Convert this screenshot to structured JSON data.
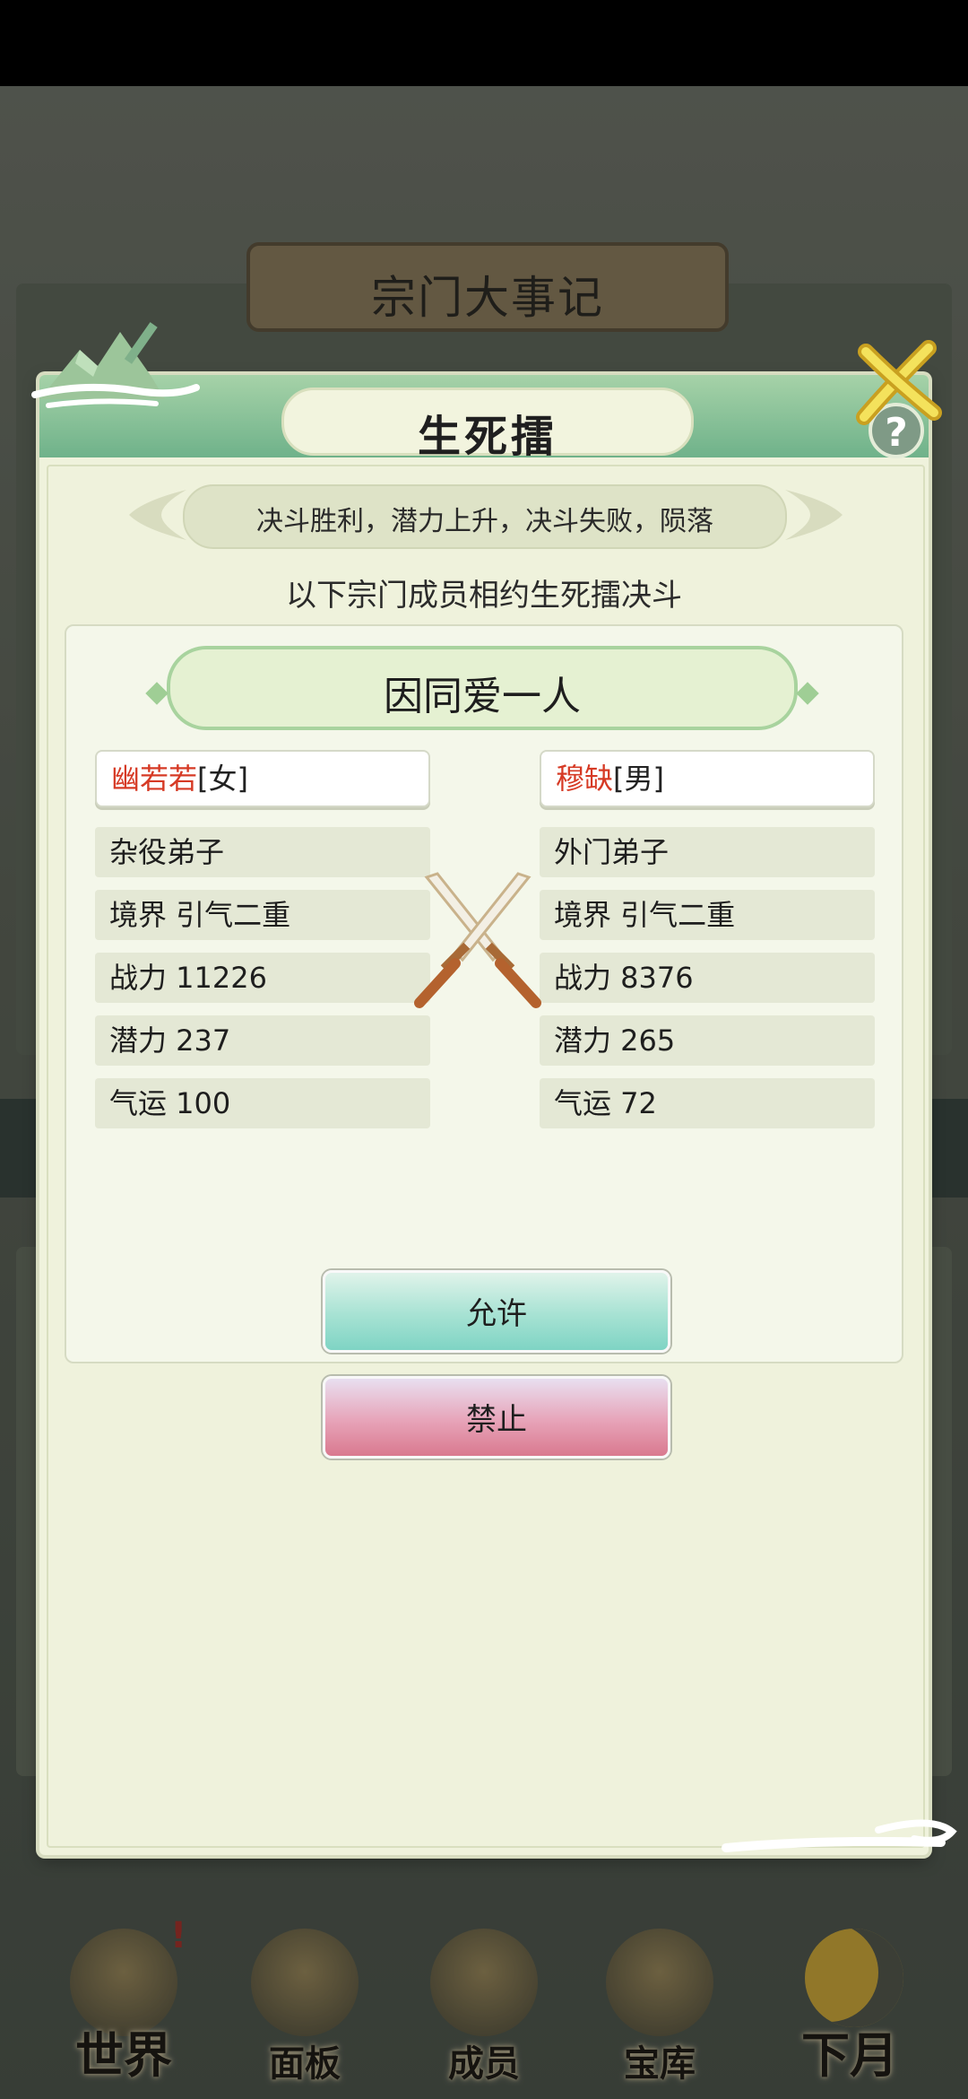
{
  "background": {
    "event_plaque_title": "宗门大事记"
  },
  "bottom_nav": {
    "items": [
      {
        "label": "世界",
        "icon": "world-pagoda-icon"
      },
      {
        "label": "面板",
        "icon": "panel-temple-icon"
      },
      {
        "label": "成员",
        "icon": "member-portrait-icon"
      },
      {
        "label": "宝库",
        "icon": "treasury-icon"
      },
      {
        "label": "下月",
        "icon": "moon-icon"
      }
    ],
    "alert_mark": "!"
  },
  "modal": {
    "title": "生死擂",
    "help_label": "?",
    "rule": "决斗胜利，潜力上升，决斗失败，陨落",
    "subtitle": "以下宗门成员相约生死擂决斗",
    "reason": "因同爱一人",
    "left": {
      "name": "幽若若",
      "gender": "[女]",
      "stats": [
        "杂役弟子",
        "境界 引气二重",
        "战力 11226",
        "潜力 237",
        "气运 100"
      ]
    },
    "right": {
      "name": "穆缺",
      "gender": "[男]",
      "stats": [
        "外门弟子",
        "境界 引气二重",
        "战力 8376",
        "潜力 265",
        "气运 72"
      ]
    },
    "allow_label": "允许",
    "forbid_label": "禁止"
  },
  "colors": {
    "header_green": "#6fb28a",
    "name_red": "#d63a25",
    "allow_teal": "#7fd4c4",
    "forbid_pink": "#d9798f"
  }
}
